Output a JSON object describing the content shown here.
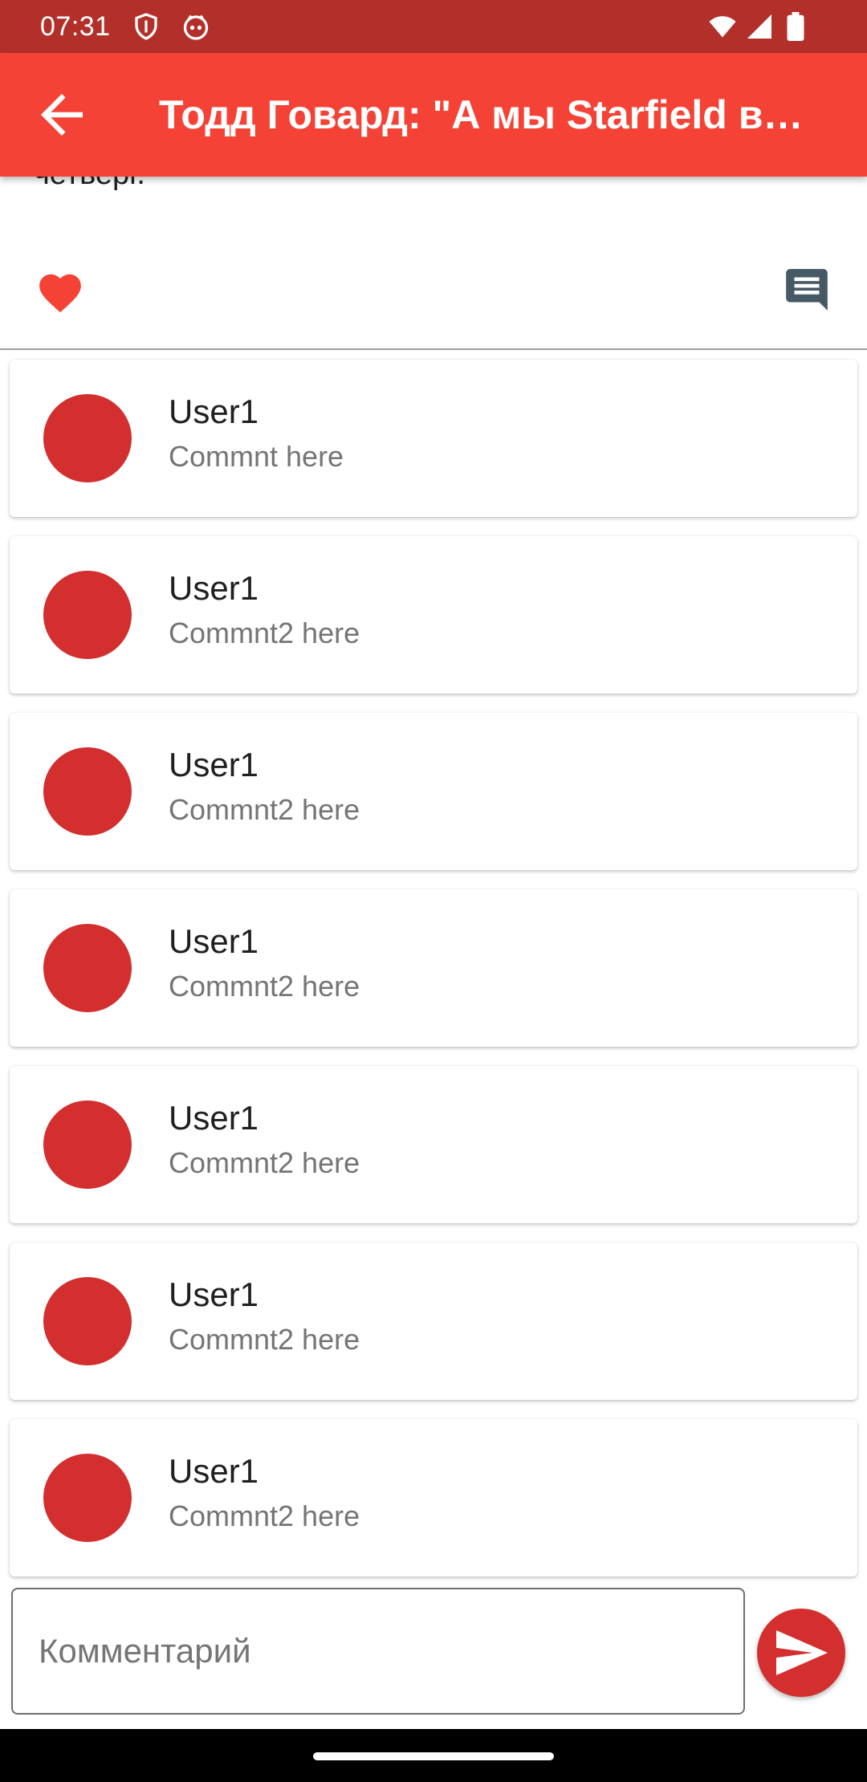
{
  "status_bar": {
    "time": "07:31",
    "icons": [
      "shield-icon",
      "notification-icon",
      "wifi-icon",
      "signal-icon",
      "battery-icon"
    ]
  },
  "app_bar": {
    "title": "Тодд Говард: \"А мы Starfield в…",
    "back_icon": "arrow-back-icon"
  },
  "article": {
    "tail_text": "четверг."
  },
  "actions": {
    "like_icon": "heart-icon",
    "comments_icon": "comment-icon"
  },
  "comments": [
    {
      "user": "User1",
      "text": "Commnt here"
    },
    {
      "user": "User1",
      "text": "Commnt2 here"
    },
    {
      "user": "User1",
      "text": "Commnt2 here"
    },
    {
      "user": "User1",
      "text": "Commnt2 here"
    },
    {
      "user": "User1",
      "text": "Commnt2 here"
    },
    {
      "user": "User1",
      "text": "Commnt2 here"
    },
    {
      "user": "User1",
      "text": "Commnt2 here"
    }
  ],
  "input": {
    "placeholder": "Комментарий",
    "value": "",
    "send_icon": "send-icon"
  },
  "colors": {
    "status_bar": "#b3302a",
    "app_bar": "#f44336",
    "accent": "#d32f2f",
    "like": "#f44336",
    "comment_icon": "#455a64"
  }
}
